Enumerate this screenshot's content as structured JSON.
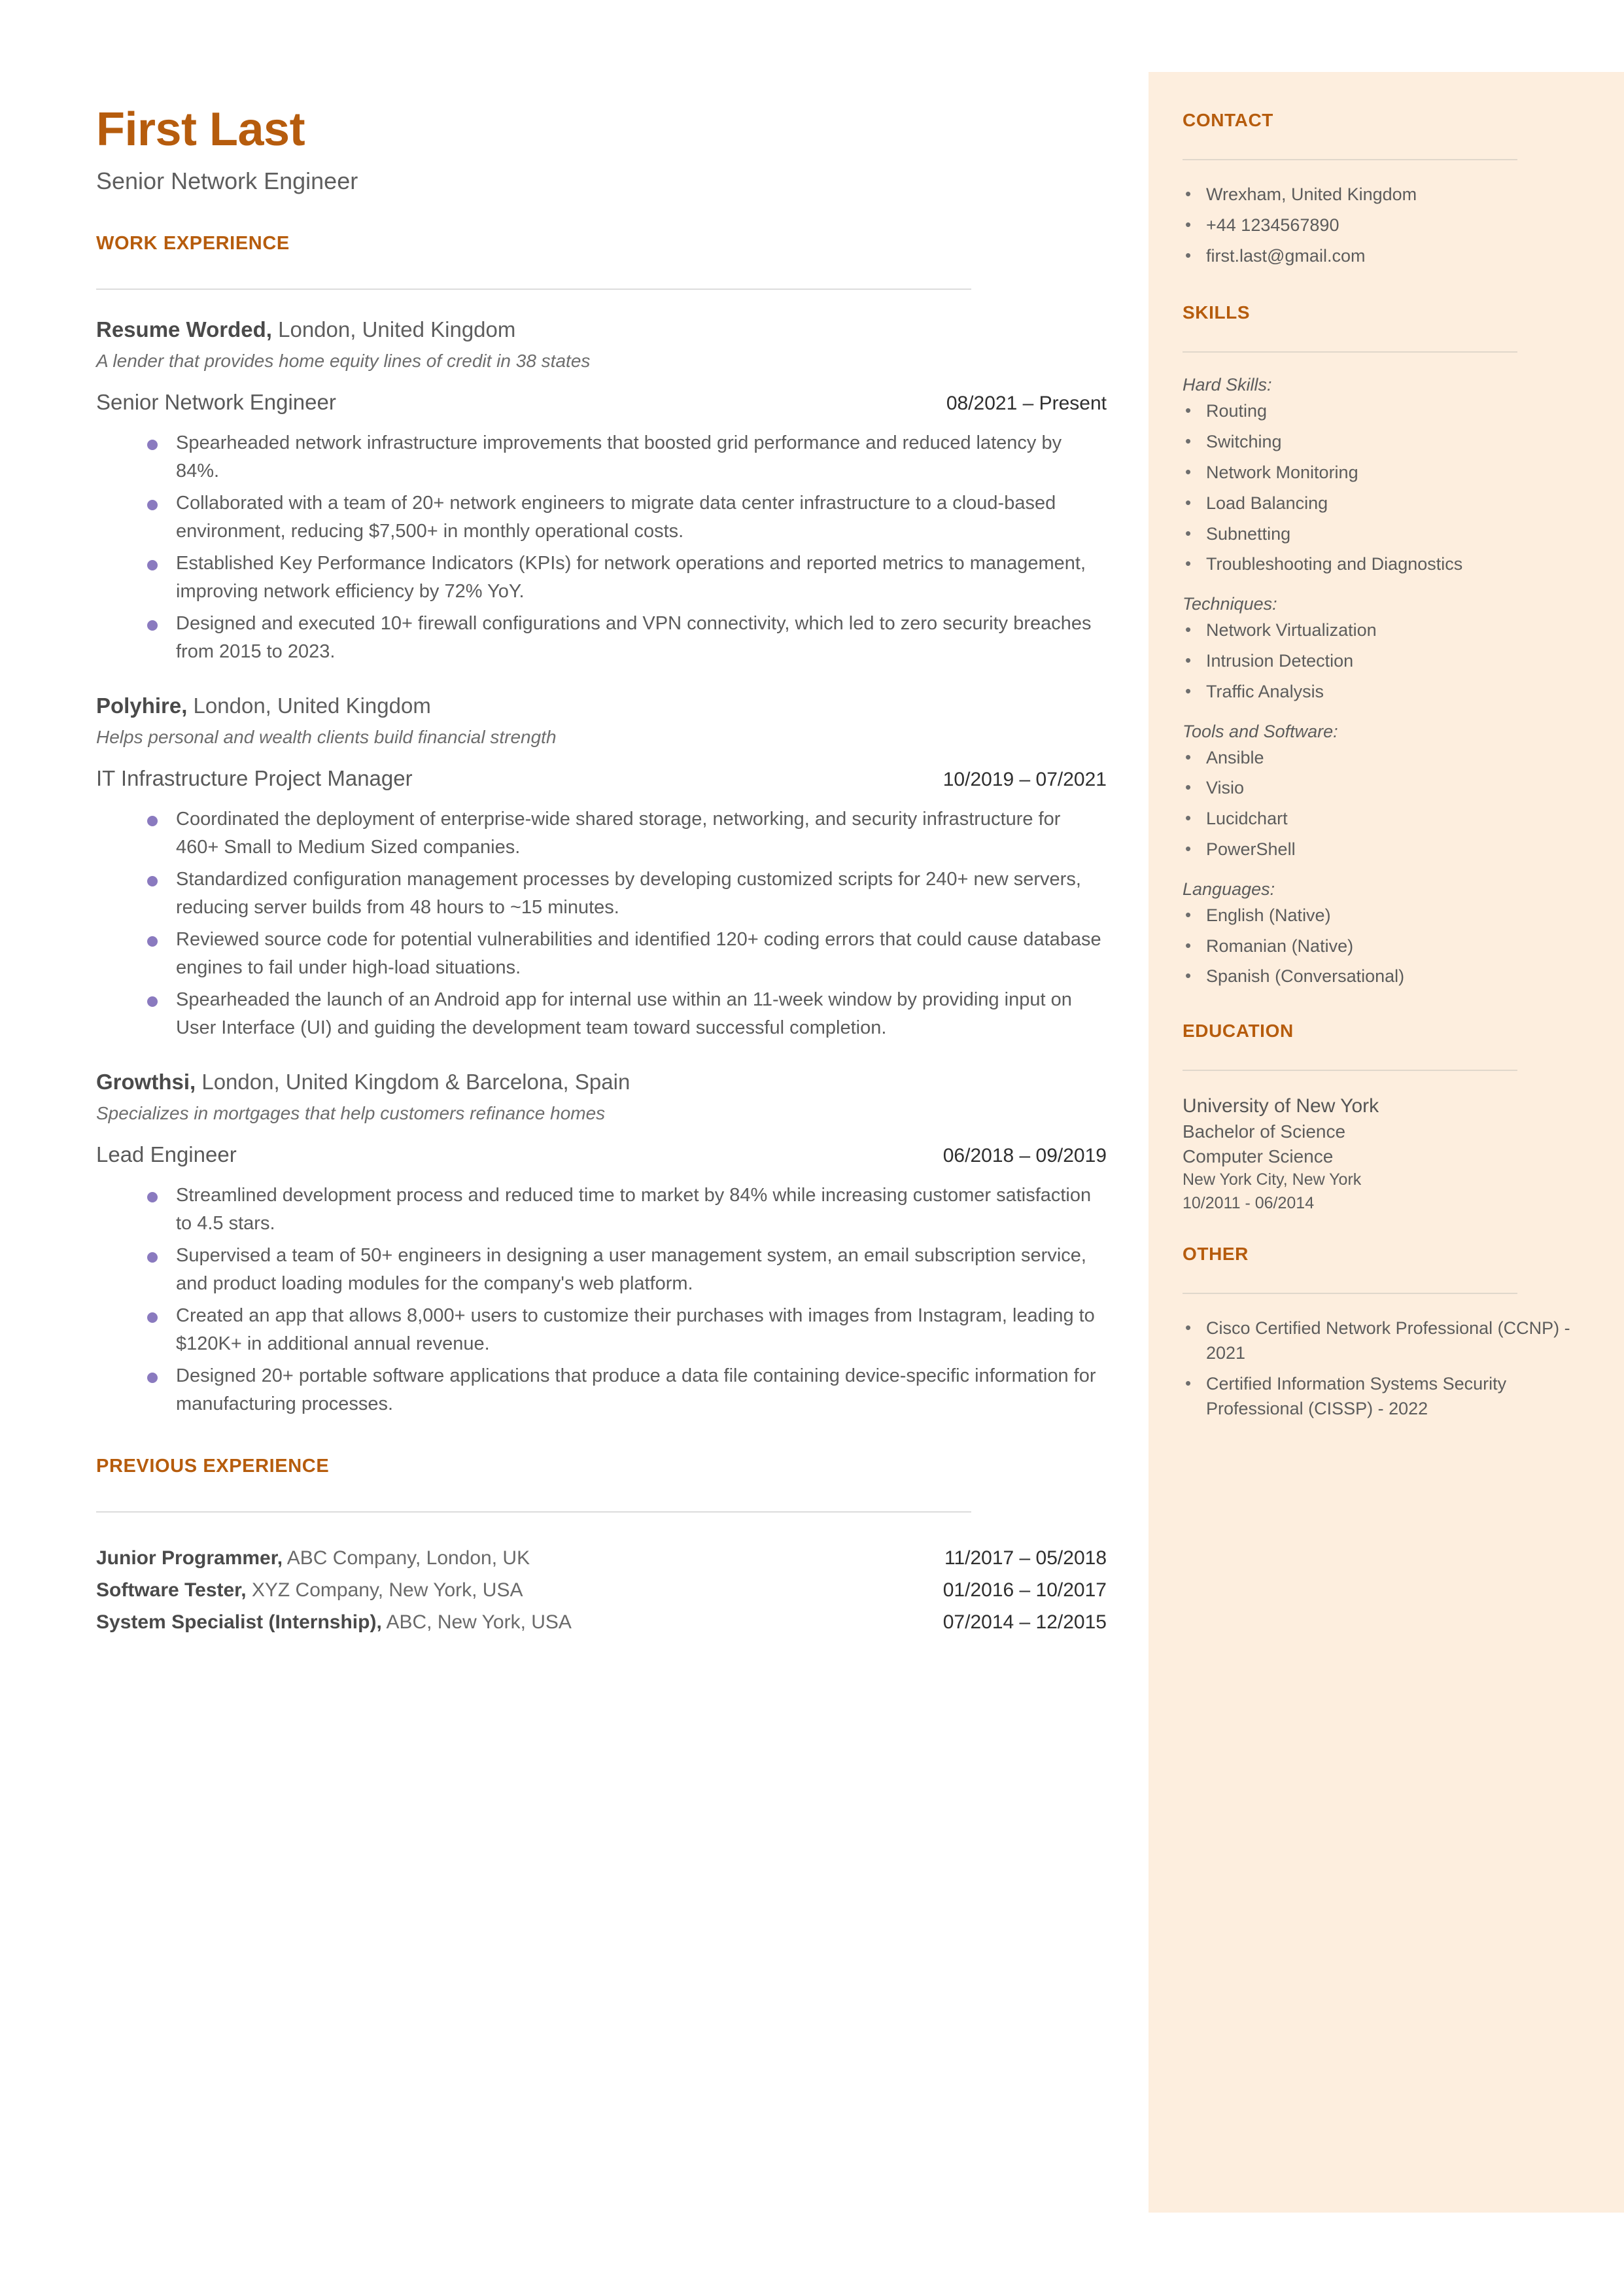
{
  "header": {
    "name": "First Last",
    "headline": "Senior Network Engineer"
  },
  "colors": {
    "accent": "#b65c0d",
    "sidebar_background": "#fdeede",
    "body_text": "#5c5c5c",
    "bullet": "#8a7abf",
    "divider": "#dcdcdc"
  },
  "main": {
    "work_experience_heading": "WORK EXPERIENCE",
    "jobs": [
      {
        "company": "Resume Worded,",
        "location": " London, United Kingdom",
        "description": "A lender that provides home equity lines of credit in 38 states",
        "title": "Senior Network Engineer",
        "dates": "08/2021 – Present",
        "bullets": [
          "Spearheaded network infrastructure improvements that boosted grid performance and reduced latency by 84%.",
          "Collaborated with a team of 20+ network engineers to migrate data center infrastructure to a cloud-based environment, reducing  $7,500+ in monthly operational costs.",
          "Established Key Performance Indicators (KPIs) for network operations and reported metrics to management, improving network efficiency by 72% YoY.",
          "Designed and executed 10+ firewall configurations and VPN connectivity, which led to zero security breaches from 2015 to 2023."
        ]
      },
      {
        "company": "Polyhire,",
        "location": " London, United Kingdom",
        "description": "Helps personal and wealth clients build financial strength",
        "title": "IT Infrastructure Project Manager",
        "dates": "10/2019 – 07/2021",
        "bullets": [
          "Coordinated the deployment of enterprise-wide shared storage, networking, and security infrastructure for 460+ Small to Medium Sized companies.",
          "Standardized configuration management processes by developing customized scripts for 240+ new servers, reducing server builds from 48 hours to ~15 minutes.",
          "Reviewed source code for potential vulnerabilities and identified 120+ coding errors that could cause database engines to fail under high-load situations.",
          "Spearheaded the launch of an Android app for internal use within an 11-week window by providing input on User Interface (UI) and guiding the development team toward successful completion."
        ]
      },
      {
        "company": "Growthsi,",
        "location": " London, United Kingdom & Barcelona, Spain",
        "description": "Specializes in mortgages that help customers refinance homes",
        "title": "Lead Engineer",
        "dates": "06/2018 – 09/2019",
        "bullets": [
          "Streamlined development process and reduced time to market by 84% while increasing customer satisfaction to 4.5 stars.",
          "Supervised a team of 50+ engineers in designing a user management system, an email subscription service, and product loading modules for the company's web platform.",
          "Created an app that allows 8,000+ users to customize their purchases with images from Instagram, leading to $120K+ in additional annual revenue.",
          "Designed 20+ portable software applications that produce a data file containing device-specific information for manufacturing processes."
        ]
      }
    ],
    "previous_experience_heading": "PREVIOUS EXPERIENCE",
    "previous": [
      {
        "title": "Junior Programmer,",
        "detail": " ABC Company, London, UK",
        "dates": "11/2017 – 05/2018"
      },
      {
        "title": "Software Tester,",
        "detail": " XYZ Company, New York, USA",
        "dates": "01/2016 – 10/2017"
      },
      {
        "title": "System Specialist (Internship),",
        "detail": " ABC, New York, USA",
        "dates": "07/2014 – 12/2015"
      }
    ]
  },
  "sidebar": {
    "contact_heading": "CONTACT",
    "contact_items": [
      "Wrexham, United Kingdom",
      "+44 1234567890",
      "first.last@gmail.com"
    ],
    "skills_heading": "SKILLS",
    "skill_groups": [
      {
        "label": "Hard Skills:",
        "items": [
          "Routing",
          "Switching",
          "Network Monitoring",
          "Load Balancing",
          "Subnetting",
          "Troubleshooting and Diagnostics"
        ]
      },
      {
        "label": "Techniques:",
        "items": [
          "Network Virtualization",
          "Intrusion Detection",
          "Traffic Analysis"
        ]
      },
      {
        "label": "Tools and Software:",
        "items": [
          "Ansible",
          "Visio",
          "Lucidchart",
          "PowerShell"
        ]
      },
      {
        "label": "Languages:",
        "items": [
          "English (Native)",
          "Romanian (Native)",
          "Spanish (Conversational)"
        ]
      }
    ],
    "education_heading": "EDUCATION",
    "education": {
      "school": "University of New York",
      "degree": "Bachelor of Science",
      "field": "Computer Science",
      "location": "New York City, New York",
      "dates": "10/2011 - 06/2014"
    },
    "other_heading": "OTHER",
    "other_items": [
      "Cisco Certified Network Professional (CCNP) - 2021",
      "Certified Information Systems Security Professional (CISSP) - 2022"
    ]
  }
}
